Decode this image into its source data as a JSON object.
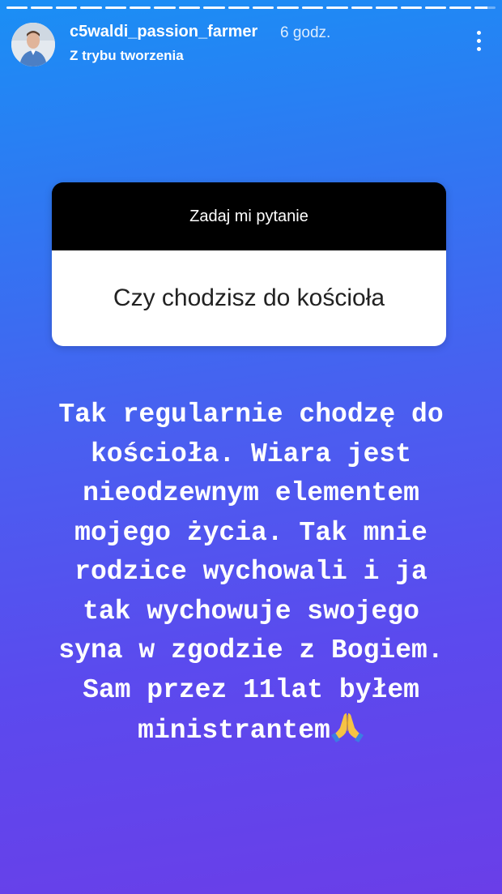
{
  "story": {
    "progress": [
      {
        "filled": 1.0
      },
      {
        "filled": 1.0
      },
      {
        "filled": 1.0
      },
      {
        "filled": 1.0
      },
      {
        "filled": 1.0
      },
      {
        "filled": 1.0
      },
      {
        "filled": 1.0
      },
      {
        "filled": 1.0
      },
      {
        "filled": 1.0
      },
      {
        "filled": 1.0
      },
      {
        "filled": 1.0
      },
      {
        "filled": 1.0
      },
      {
        "filled": 1.0
      },
      {
        "filled": 1.0
      },
      {
        "filled": 1.0
      },
      {
        "filled": 1.0
      },
      {
        "filled": 1.0
      },
      {
        "filled": 1.0
      },
      {
        "filled": 1.0
      },
      {
        "filled": 0.6
      }
    ],
    "colors": {
      "gradient_top": "#1a8ff5",
      "gradient_bottom": "#6a3ee8",
      "card_header": "#000000",
      "card_body": "#ffffff"
    }
  },
  "header": {
    "username": "c5waldi_passion_farmer",
    "time_ago": "6 godz.",
    "subtitle": "Z trybu tworzenia",
    "avatar_icon": "profile-photo",
    "menu_icon": "more-vertical-icon"
  },
  "question_card": {
    "title": "Zadaj mi pytanie",
    "question": "Czy chodzisz do kościoła"
  },
  "answer": {
    "lines": [
      "Tak regularnie chodzę do",
      "kościoła. Wiara jest",
      "nieodzewnym elementem",
      "mojego życia. Tak mnie",
      "rodzice wychowali i ja",
      "tak wychowuje swojego",
      "syna w zgodzie z Bogiem.",
      "Sam przez 11lat byłem",
      "ministrantem"
    ],
    "emoji": "folded-hands-icon"
  }
}
